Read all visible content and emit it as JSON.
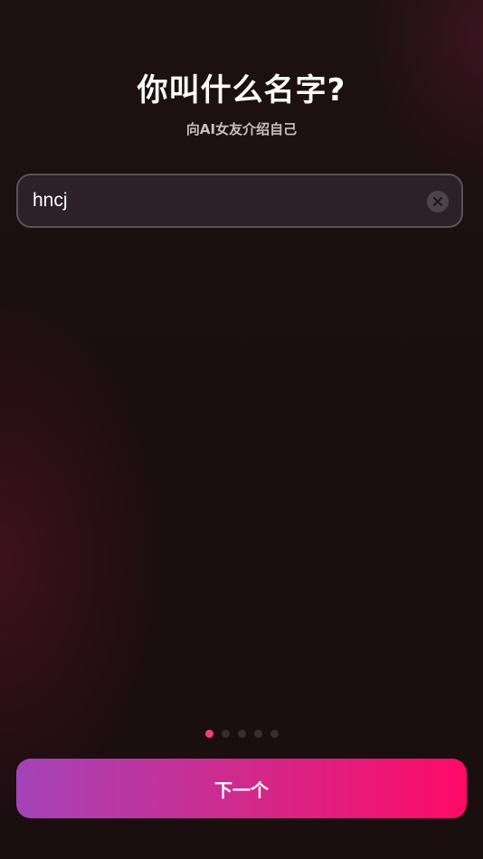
{
  "header": {
    "title": "你叫什么名字?",
    "subtitle": "向AI女友介绍自己"
  },
  "name_field": {
    "value": "hncj",
    "clear_icon": "close-circle-icon"
  },
  "pager": {
    "total": 5,
    "current": 1
  },
  "footer": {
    "next_label": "下一个"
  },
  "colors": {
    "background": "#1a0f11",
    "accent_pink": "#ff0a67",
    "accent_purple": "#a443b8",
    "active_dot": "#f0407a"
  }
}
